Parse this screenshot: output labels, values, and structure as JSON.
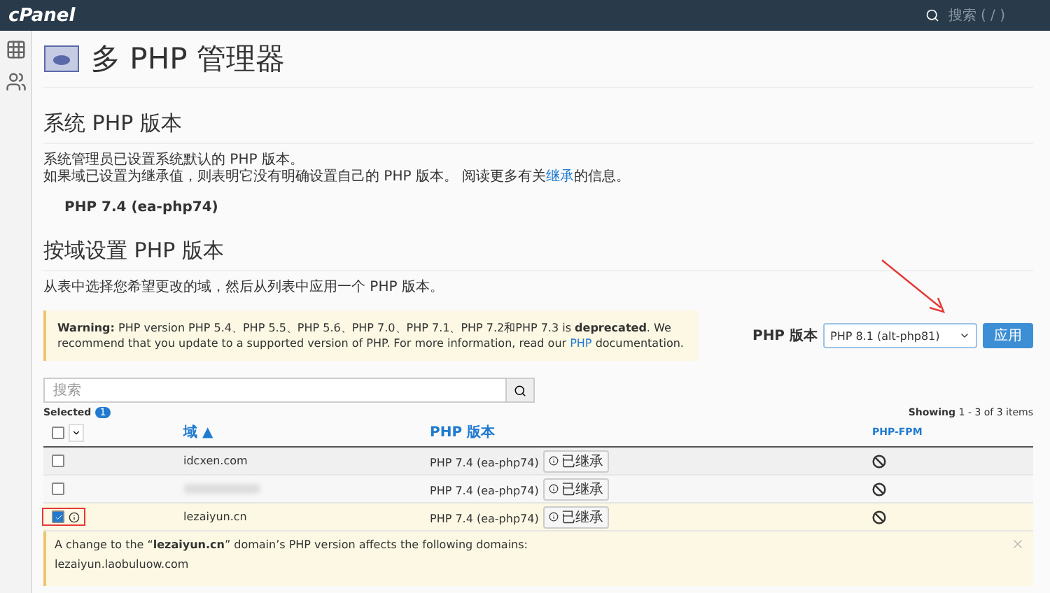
{
  "topbar": {
    "logo": "cPanel",
    "search_placeholder": "搜索 ( / )"
  },
  "page_title": "多 PHP 管理器",
  "system": {
    "heading": "系统 PHP 版本",
    "line": "系统管理员已设置系统默认的 PHP 版本。",
    "inherit_before": "如果域已设置为继承值，则表明它没有明确设置自己的 PHP 版本。 阅读更多有关",
    "inherit_link": "继承",
    "inherit_after": "的信息。",
    "version": "PHP 7.4 (ea-php74)"
  },
  "domains_section": {
    "heading": "按域设置 PHP 版本",
    "description": "从表中选择您希望更改的域，然后从列表中应用一个 PHP 版本。"
  },
  "warning": {
    "label": "Warning:",
    "text_before": "PHP version PHP 5.4、PHP 5.5、PHP 5.6、PHP 7.0、PHP 7.1、PHP 7.2和PHP 7.3 is",
    "bold": "deprecated",
    "text_after": ". We recommend that you update to a supported version of PHP. For more information, read our",
    "link": "PHP",
    "text_end": "documentation."
  },
  "version_picker": {
    "label": "PHP 版本",
    "value": "PHP 8.1 (alt-php81)",
    "button": "应用"
  },
  "search": {
    "placeholder": "搜索"
  },
  "selected": {
    "label": "Selected",
    "count": "1"
  },
  "showing": {
    "label": "Showing",
    "range": "1 - 3 of 3 items"
  },
  "table": {
    "select_all_checked": false,
    "columns": [
      "域 ▲",
      "PHP 版本",
      "PHP-FPM"
    ],
    "rows": [
      {
        "domain": "idcxen.com",
        "blurred": false,
        "version": "PHP 7.4 (ea-php74)",
        "badge": "已继承",
        "checked": false,
        "fpm_enabled": false,
        "annotated": false
      },
      {
        "blurred": true,
        "version": "PHP 7.4 (ea-php74)",
        "badge": "已继承",
        "checked": false,
        "fpm_enabled": false,
        "annotated": false
      },
      {
        "domain": "lezaiyun.cn",
        "blurred": false,
        "version": "PHP 7.4 (ea-php74)",
        "badge": "已继承",
        "checked": true,
        "fpm_enabled": false,
        "annotated": true
      }
    ]
  },
  "notice": {
    "before": "A change to the “**lezaiyun.cn**” domain’s PHP version affects the following domains:",
    "domains": [
      "lezaiyun.laobuluow.com"
    ]
  }
}
